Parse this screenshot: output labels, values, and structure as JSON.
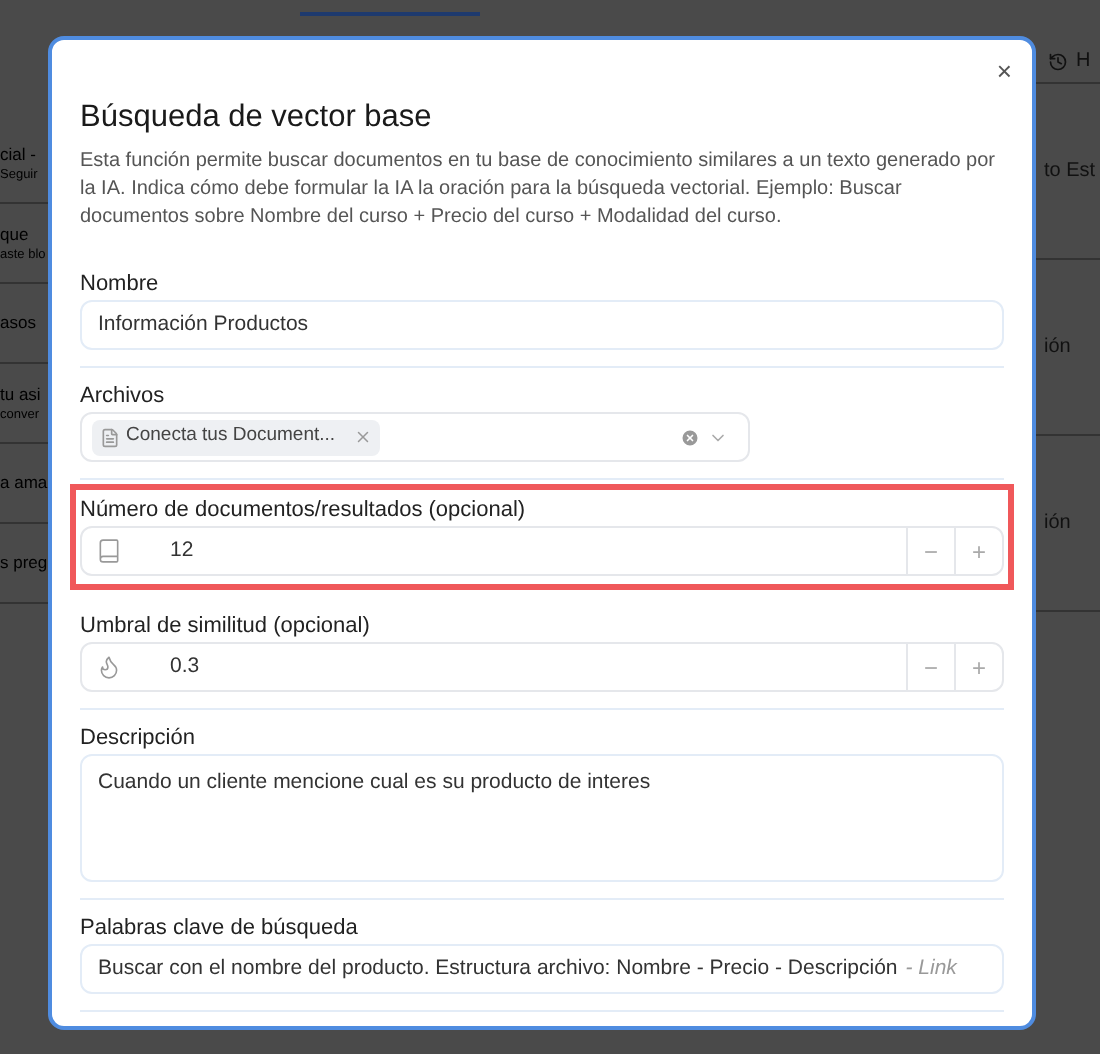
{
  "background": {
    "left_items": [
      {
        "title": "cial -",
        "subtitle": "Seguir"
      },
      {
        "title": "que",
        "subtitle": "aste blo"
      },
      {
        "title": "asos"
      },
      {
        "title": "tu asi",
        "subtitle": "conver"
      },
      {
        "title": "a ama"
      },
      {
        "title": "s preg"
      }
    ],
    "right_items": [
      {
        "kind": "history",
        "text": "H"
      },
      {
        "kind": "text",
        "text": "to Est"
      },
      {
        "kind": "text",
        "text": "ión"
      },
      {
        "kind": "text",
        "text": "ión"
      }
    ]
  },
  "dialog": {
    "title": "Búsqueda de vector base",
    "close": "×",
    "description": "Esta función permite buscar documentos en tu base de conocimiento similares a un texto generado por la IA. Indica cómo debe formular la IA la oración para la búsqueda vectorial. Ejemplo: Buscar documentos sobre Nombre del curso + Precio del curso + Modalidad del curso.",
    "fields": [
      {
        "kind": "text",
        "label": "Nombre",
        "value": "Información Productos",
        "highlighted": false
      },
      {
        "kind": "select",
        "label": "Archivos",
        "chips": [
          "Conecta tus Document..."
        ],
        "highlighted": false
      },
      {
        "kind": "number",
        "label": "Número de documentos/resultados (opcional)",
        "value": "12",
        "minus": "−",
        "plus": "+",
        "highlighted": true
      },
      {
        "kind": "number",
        "label": "Umbral de similitud (opcional)",
        "value": "0.3",
        "minus": "−",
        "plus": "+",
        "highlighted": false
      },
      {
        "kind": "textarea",
        "label": "Descripción",
        "value": "Cuando un cliente mencione cual es su producto de interes",
        "highlighted": false
      },
      {
        "kind": "text",
        "label": "Palabras clave de búsqueda",
        "value": "Buscar con el nombre del producto. Estructura archivo: Nombre - Precio - Descripción",
        "hint": "- Link",
        "highlighted": false
      }
    ]
  }
}
